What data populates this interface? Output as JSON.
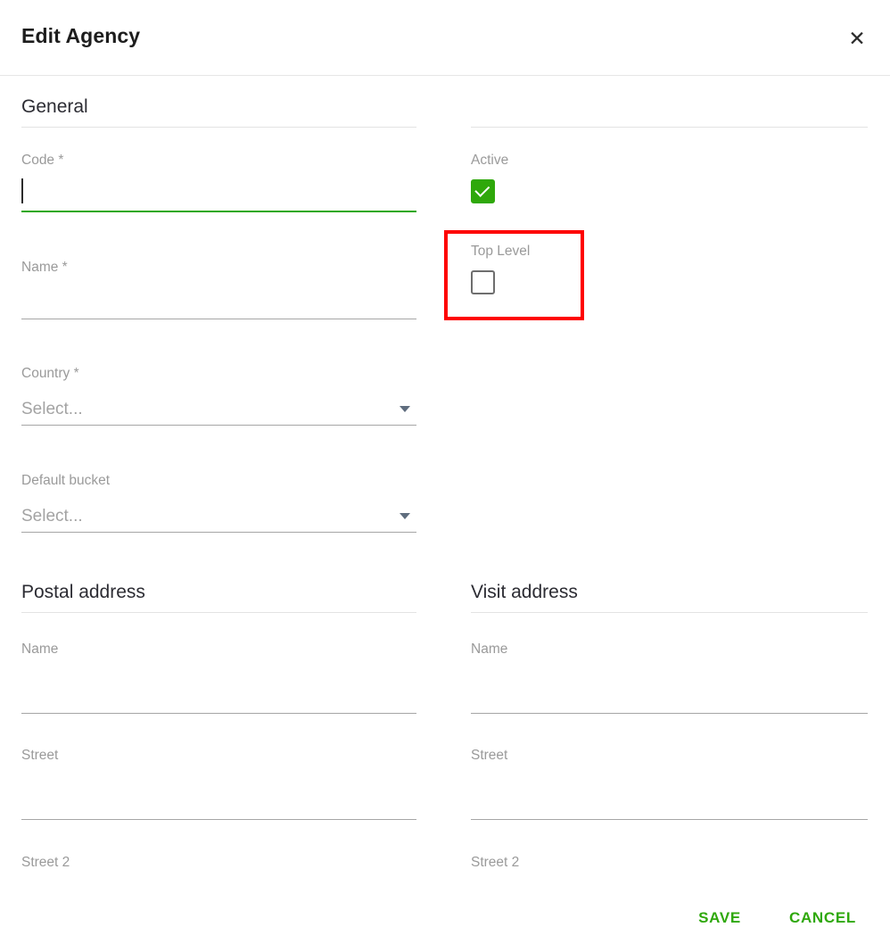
{
  "dialog": {
    "title": "Edit Agency",
    "close_icon": "close-icon"
  },
  "general": {
    "heading": "General",
    "code": {
      "label": "Code *",
      "value": "",
      "focused": true
    },
    "name": {
      "label": "Name *",
      "value": ""
    },
    "country": {
      "label": "Country *",
      "placeholder": "Select...",
      "value": "",
      "icon": "chevron-down-icon"
    },
    "default_bucket": {
      "label": "Default bucket",
      "placeholder": "Select...",
      "value": "",
      "icon": "chevron-down-icon"
    },
    "active": {
      "label": "Active",
      "checked": true
    },
    "top_level": {
      "label": "Top Level",
      "checked": false
    }
  },
  "postal_address": {
    "heading": "Postal address",
    "fields": [
      {
        "label": "Name",
        "value": ""
      },
      {
        "label": "Street",
        "value": ""
      },
      {
        "label": "Street 2",
        "value": ""
      }
    ]
  },
  "visit_address": {
    "heading": "Visit address",
    "fields": [
      {
        "label": "Name",
        "value": ""
      },
      {
        "label": "Street",
        "value": ""
      },
      {
        "label": "Street 2",
        "value": ""
      }
    ]
  },
  "footer": {
    "save_label": "SAVE",
    "cancel_label": "CANCEL"
  },
  "colors": {
    "accent_green": "#2fa80b",
    "annotation_red": "#fe0000",
    "label_gray": "#9a9a9a",
    "heading_dark": "#2c2c33"
  }
}
